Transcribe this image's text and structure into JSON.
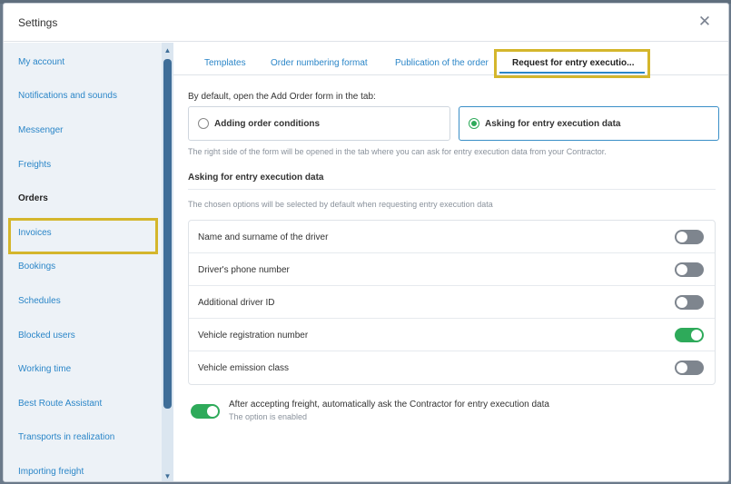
{
  "window": {
    "title": "Settings"
  },
  "sidebar": {
    "items": [
      {
        "label": "My account",
        "active": false
      },
      {
        "label": "Notifications and sounds",
        "active": false
      },
      {
        "label": "Messenger",
        "active": false
      },
      {
        "label": "Freights",
        "active": false
      },
      {
        "label": "Orders",
        "active": true
      },
      {
        "label": "Invoices",
        "active": false
      },
      {
        "label": "Bookings",
        "active": false
      },
      {
        "label": "Schedules",
        "active": false
      },
      {
        "label": "Blocked users",
        "active": false
      },
      {
        "label": "Working time",
        "active": false
      },
      {
        "label": "Best Route Assistant",
        "active": false
      },
      {
        "label": "Transports in realization",
        "active": false
      },
      {
        "label": "Importing freight",
        "active": false
      }
    ]
  },
  "tabs": [
    {
      "label": "Templates",
      "active": false
    },
    {
      "label": "Order numbering format",
      "active": false
    },
    {
      "label": "Publication of the order",
      "active": false
    },
    {
      "label": "Request for entry executio...",
      "active": true
    }
  ],
  "form": {
    "default_label": "By default, open the Add Order form in the tab:",
    "radio_options": [
      {
        "label": "Adding order conditions",
        "selected": false
      },
      {
        "label": "Asking for entry execution data",
        "selected": true
      }
    ],
    "hint": "The right side of the form will be opened in the tab where you can ask for entry execution data from your Contractor.",
    "section_title": "Asking for entry execution data",
    "section_hint": "The chosen options will be selected by default when requesting entry execution data",
    "options": [
      {
        "label": "Name and surname of the driver",
        "enabled": false
      },
      {
        "label": "Driver's phone number",
        "enabled": false
      },
      {
        "label": "Additional driver ID",
        "enabled": false
      },
      {
        "label": "Vehicle registration number",
        "enabled": true
      },
      {
        "label": "Vehicle emission class",
        "enabled": false
      }
    ],
    "auto_ask": {
      "label": "After accepting freight, automatically ask the Contractor for entry execution data",
      "status": "The option is enabled",
      "enabled": true
    }
  },
  "colors": {
    "accent": "#2b86c8",
    "toggle_on": "#2eaa5a",
    "toggle_off": "#7e858e",
    "highlight": "#d4b62c"
  },
  "icons": {
    "close": "close-icon",
    "scroll_up": "scroll-up-arrow-icon",
    "scroll_down": "scroll-down-arrow-icon"
  }
}
